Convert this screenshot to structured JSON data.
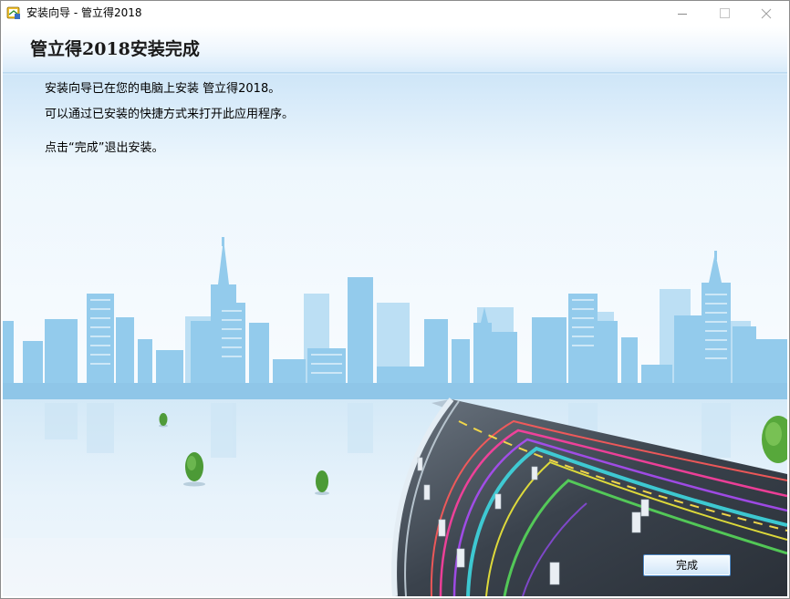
{
  "window": {
    "title": "安装向导 - 管立得2018"
  },
  "header": {
    "title": "管立得2018安装完成"
  },
  "content": {
    "line1": "安装向导已在您的电脑上安装 管立得2018。",
    "line2": "可以通过已安装的快捷方式来打开此应用程序。",
    "line3": "点击“完成”退出安装。"
  },
  "buttons": {
    "finish_label": "完成"
  },
  "icons": {
    "app": "app-icon",
    "minimize": "minimize-icon",
    "maximize": "maximize-icon",
    "close": "close-icon"
  },
  "colors": {
    "sky_top": "#d9ecfa",
    "building": "#8ec8eb",
    "road": "#3c4652",
    "accent_button_border": "#4f8bc8"
  }
}
